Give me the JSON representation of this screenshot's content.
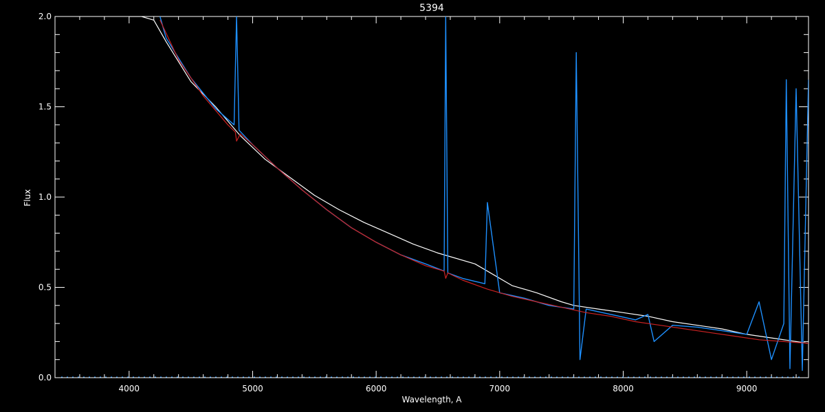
{
  "chart_data": {
    "type": "line",
    "title": "5394",
    "xlabel": "Wavelength, A",
    "ylabel": "Flux",
    "xlim": [
      3400,
      9500
    ],
    "ylim": [
      0.0,
      2.0
    ],
    "x_ticks": [
      4000,
      5000,
      6000,
      7000,
      8000,
      9000
    ],
    "x_tick_labels": [
      "4000",
      "5000",
      "6000",
      "7000",
      "8000",
      "9000"
    ],
    "y_ticks": [
      0.0,
      0.5,
      1.0,
      1.5,
      2.0
    ],
    "y_tick_labels": [
      "0.0",
      "0.5",
      "1.0",
      "1.5",
      "2.0"
    ],
    "grid": false,
    "background": "#000000",
    "colors": {
      "axes": "#ffffff",
      "observed": "#ffffff",
      "fit": "#1e90ff",
      "model": "#cc2222"
    },
    "series": [
      {
        "key": "observed",
        "x": [
          4000,
          4100,
          4200,
          4300,
          4500,
          4700,
          4900,
          5100,
          5300,
          5500,
          5700,
          5900,
          6100,
          6300,
          6500,
          6800,
          6900,
          7100,
          7300,
          7500,
          7600,
          7800,
          8000,
          8200,
          8400,
          8600,
          8800,
          9000,
          9200,
          9400,
          9500
        ],
        "y": [
          2.0,
          2.0,
          1.98,
          1.86,
          1.64,
          1.5,
          1.34,
          1.21,
          1.11,
          1.01,
          0.93,
          0.86,
          0.8,
          0.74,
          0.69,
          0.63,
          0.59,
          0.51,
          0.47,
          0.42,
          0.4,
          0.38,
          0.36,
          0.34,
          0.31,
          0.29,
          0.27,
          0.24,
          0.22,
          0.2,
          0.19
        ]
      },
      {
        "key": "fit",
        "x": [
          4250,
          4300,
          4500,
          4700,
          4850,
          4870,
          4890,
          5000,
          5200,
          5400,
          5600,
          5800,
          6000,
          6200,
          6400,
          6550,
          6563,
          6580,
          6700,
          6880,
          6900,
          7000,
          7200,
          7400,
          7600,
          7620,
          7650,
          7700,
          7900,
          8100,
          8200,
          8250,
          8400,
          8600,
          8800,
          9000,
          9100,
          9200,
          9300,
          9320,
          9350,
          9400,
          9450,
          9500
        ],
        "y": [
          2.0,
          1.88,
          1.66,
          1.49,
          1.4,
          2.0,
          1.37,
          1.29,
          1.16,
          1.04,
          0.93,
          0.83,
          0.75,
          0.68,
          0.63,
          0.59,
          2.0,
          0.58,
          0.55,
          0.52,
          0.97,
          0.47,
          0.44,
          0.4,
          0.38,
          1.8,
          0.1,
          0.38,
          0.35,
          0.32,
          0.35,
          0.2,
          0.29,
          0.28,
          0.26,
          0.24,
          0.42,
          0.1,
          0.3,
          1.65,
          0.05,
          1.6,
          0.04,
          1.65
        ]
      },
      {
        "key": "model",
        "x": [
          4250,
          4400,
          4600,
          4800,
          4860,
          4870,
          4900,
          5000,
          5200,
          5400,
          5600,
          5800,
          6000,
          6200,
          6400,
          6550,
          6563,
          6580,
          6700,
          6900,
          7100,
          7300,
          7500,
          7700,
          7900,
          8100,
          8300,
          8500,
          8700,
          8900,
          9100,
          9300,
          9500
        ],
        "y": [
          1.98,
          1.76,
          1.56,
          1.4,
          1.36,
          1.31,
          1.35,
          1.29,
          1.16,
          1.04,
          0.93,
          0.83,
          0.75,
          0.68,
          0.62,
          0.59,
          0.55,
          0.58,
          0.54,
          0.49,
          0.45,
          0.42,
          0.39,
          0.36,
          0.34,
          0.31,
          0.29,
          0.27,
          0.25,
          0.23,
          0.21,
          0.2,
          0.19
        ]
      }
    ]
  }
}
